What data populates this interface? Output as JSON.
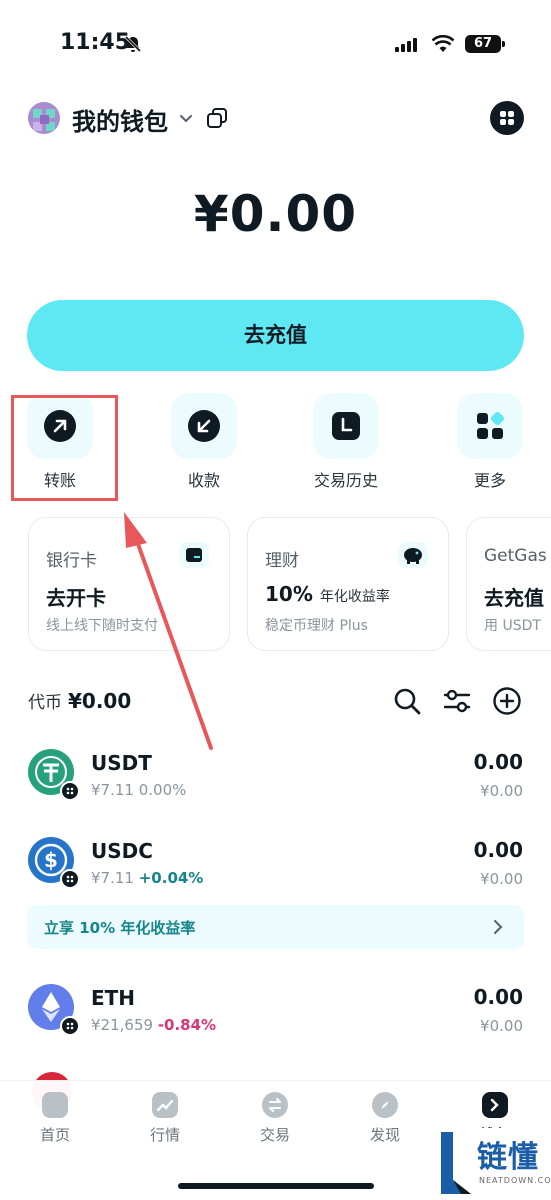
{
  "status": {
    "time": "11:45",
    "battery": "67"
  },
  "header": {
    "title": "我的钱包"
  },
  "balance": "¥0.00",
  "topup_label": "去充值",
  "actions": [
    {
      "label": "转账",
      "icon": "send-arrow-icon"
    },
    {
      "label": "收款",
      "icon": "receive-arrow-icon"
    },
    {
      "label": "交易历史",
      "icon": "history-icon"
    },
    {
      "label": "更多",
      "icon": "more-grid-icon"
    }
  ],
  "cards": [
    {
      "title": "银行卡",
      "main": "去开卡",
      "main_small": "",
      "sub": "线上线下随时支付"
    },
    {
      "title": "理财",
      "main": "10%",
      "main_small": "年化收益率",
      "sub": "稳定币理财 Plus"
    },
    {
      "title": "GetGas",
      "main": "去充值",
      "main_small": "",
      "sub": "用 USDT"
    }
  ],
  "tokens_header": {
    "label": "代币",
    "total": "¥0.00"
  },
  "tokens": [
    {
      "name": "USDT",
      "price": "¥7.11",
      "change": "0.00%",
      "amount": "0.00",
      "value": "¥0.00",
      "color": "#26a17b"
    },
    {
      "name": "USDC",
      "price": "¥7.11",
      "change": "+0.04%",
      "amount": "0.00",
      "value": "¥0.00",
      "color": "#2775ca"
    },
    {
      "name": "ETH",
      "price": "¥21,659",
      "change": "-0.84%",
      "amount": "0.00",
      "value": "¥0.00",
      "color": "#627eea"
    }
  ],
  "promo": "立享 10% 年化收益率",
  "nav": [
    {
      "label": "首页"
    },
    {
      "label": "行情"
    },
    {
      "label": "交易"
    },
    {
      "label": "发现"
    },
    {
      "label": "钱包"
    }
  ],
  "watermark": {
    "text": "链懂",
    "sub": "NEATDOWN.COM"
  },
  "colors": {
    "accent": "#5ee8f4",
    "dark": "#0f1a22",
    "positive": "#17868c",
    "negative": "#d9367a",
    "annotation": "#e8575a"
  }
}
